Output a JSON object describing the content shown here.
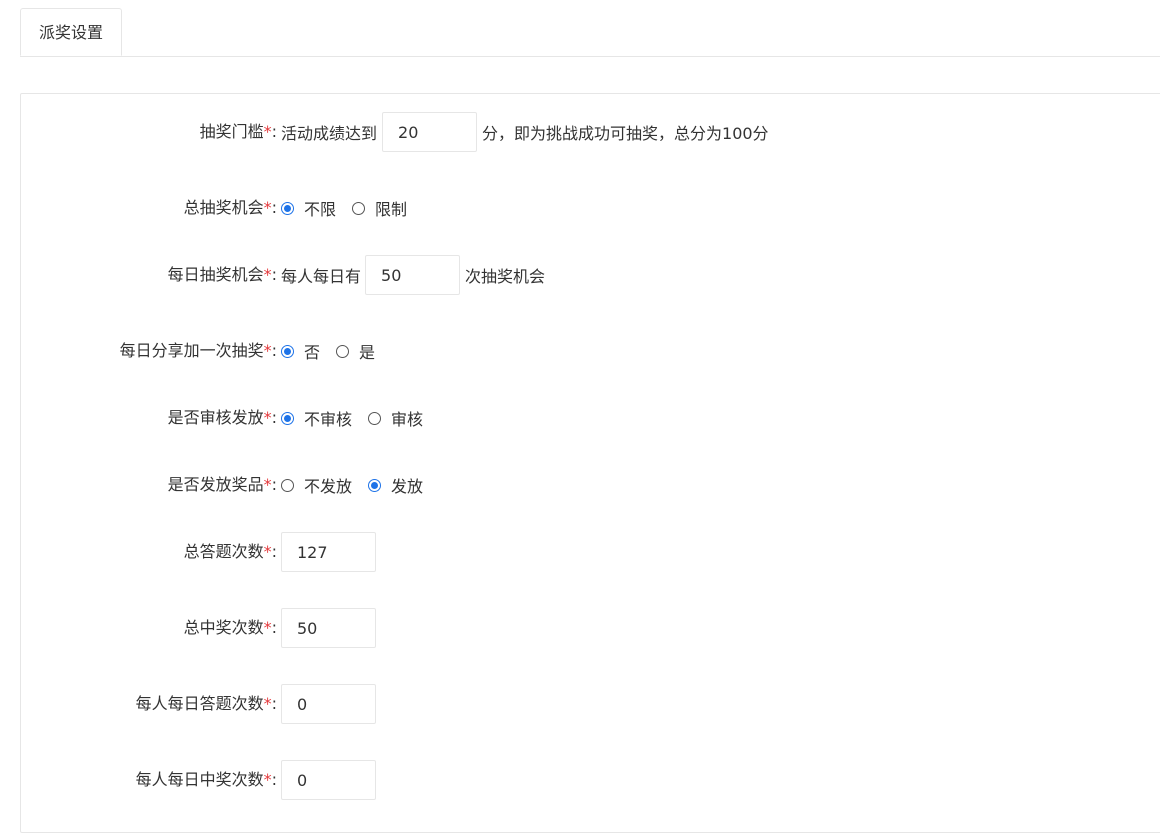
{
  "tab": {
    "label": "派奖设置"
  },
  "form": {
    "threshold": {
      "label": "抽奖门槛",
      "prefix": "活动成绩达到",
      "value": "20",
      "suffix": "分，即为挑战成功可抽奖，总分为100分"
    },
    "total_chances": {
      "label": "总抽奖机会",
      "options": [
        "不限",
        "限制"
      ],
      "selected": 0
    },
    "daily_chances": {
      "label": "每日抽奖机会",
      "prefix": "每人每日有",
      "value": "50",
      "suffix": "次抽奖机会"
    },
    "daily_share_bonus": {
      "label": "每日分享加一次抽奖",
      "options": [
        "否",
        "是"
      ],
      "selected": 0
    },
    "review_payout": {
      "label": "是否审核发放",
      "options": [
        "不审核",
        "审核"
      ],
      "selected": 0
    },
    "issue_prize": {
      "label": "是否发放奖品",
      "options": [
        "不发放",
        "发放"
      ],
      "selected": 1
    },
    "total_answers": {
      "label": "总答题次数",
      "value": "127"
    },
    "total_wins": {
      "label": "总中奖次数",
      "value": "50"
    },
    "daily_answers": {
      "label": "每人每日答题次数",
      "value": "0"
    },
    "daily_wins": {
      "label": "每人每日中奖次数",
      "value": "0"
    },
    "required_mark": "*",
    "label_colon": ":"
  },
  "colors": {
    "accent": "#1e73e8",
    "required": "#e4393c",
    "border": "#e6e6e6"
  }
}
